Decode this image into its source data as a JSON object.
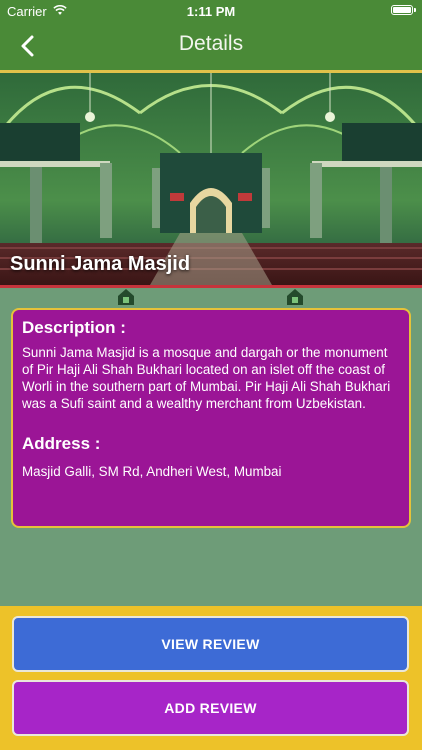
{
  "status_bar": {
    "carrier": "Carrier",
    "time": "1:11 PM"
  },
  "nav": {
    "title": "Details",
    "back_icon": "chevron-left-icon"
  },
  "place": {
    "name": "Sunni Jama Masjid"
  },
  "description": {
    "heading": "Description :",
    "text": "Sunni Jama Masjid is a mosque and dargah or the monument of Pir Haji Ali Shah Bukhari located on an islet off the coast of Worli in the southern part of Mumbai. Pir Haji Ali Shah Bukhari was a Sufi saint and a wealthy merchant from Uzbekistan."
  },
  "address": {
    "heading": "Address :",
    "text": "Masjid Galli, SM Rd, Andheri West, Mumbai"
  },
  "actions": {
    "view_review": "VIEW REVIEW",
    "add_review": "ADD REVIEW"
  },
  "colors": {
    "nav": "#4a8a37",
    "background": "#6e9c78",
    "card": "#9b1596",
    "card_border": "#e5c23a",
    "bottom_panel": "#edc229",
    "view_button": "#3d6bd6",
    "add_button": "#a725c8"
  }
}
